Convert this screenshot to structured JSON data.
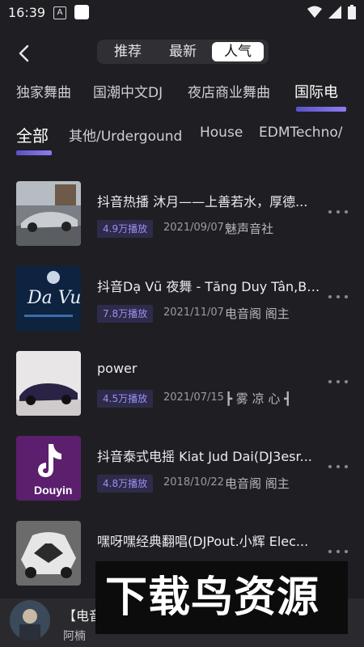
{
  "status_bar": {
    "time": "16:39",
    "a_icon_text": "A"
  },
  "header": {
    "segments": [
      "推荐",
      "最新",
      "人气"
    ],
    "active_segment": "人气"
  },
  "category_tabs": [
    "独家舞曲",
    "国潮中文DJ",
    "夜店商业舞曲",
    "国际电"
  ],
  "active_category": "国际电",
  "sub_tabs": [
    "全部",
    "其他/Urdergound",
    "House",
    "EDMTechno/"
  ],
  "active_sub_tab": "全部",
  "tracks": [
    {
      "title": "抖音热播 沐月——上善若水，厚德...",
      "plays": "4.9万播放",
      "date": "2021/09/07",
      "author": "魅声音社",
      "thumb_icon": "sports-car-thumbnail"
    },
    {
      "title": "抖音Dạ Vũ 夜舞 - Tăng Duy Tân,BA...",
      "plays": "7.8万播放",
      "date": "2021/11/07",
      "author": "电音阁 阁主",
      "thumb_icon": "da-vu-album-thumbnail"
    },
    {
      "title": "power",
      "plays": "4.5万播放",
      "date": "2021/07/15",
      "author": "┣ 雾 凉 心 ┫",
      "thumb_icon": "purple-car-thumbnail"
    },
    {
      "title": "抖音泰式电摇 Kiat Jud Dai(DJ3esr...",
      "plays": "4.8万播放",
      "date": "2018/10/22",
      "author": "电音阁 阁主",
      "thumb_icon": "douyin-logo-thumbnail"
    },
    {
      "title": "嘿呀嘿经典翻唱(DJPout.小辉 Elec...",
      "plays": "",
      "date": "",
      "author": "",
      "thumb_icon": "white-car-thumbnail"
    }
  ],
  "player": {
    "title": "【电音",
    "artist": "阿楠"
  },
  "watermark": {
    "text": "下载鸟资源"
  },
  "colors": {
    "background": "#1f1f23",
    "accent": "#7b6ee8",
    "badge_text": "#9a8ff0",
    "badge_bg": "#2e2b4a"
  }
}
